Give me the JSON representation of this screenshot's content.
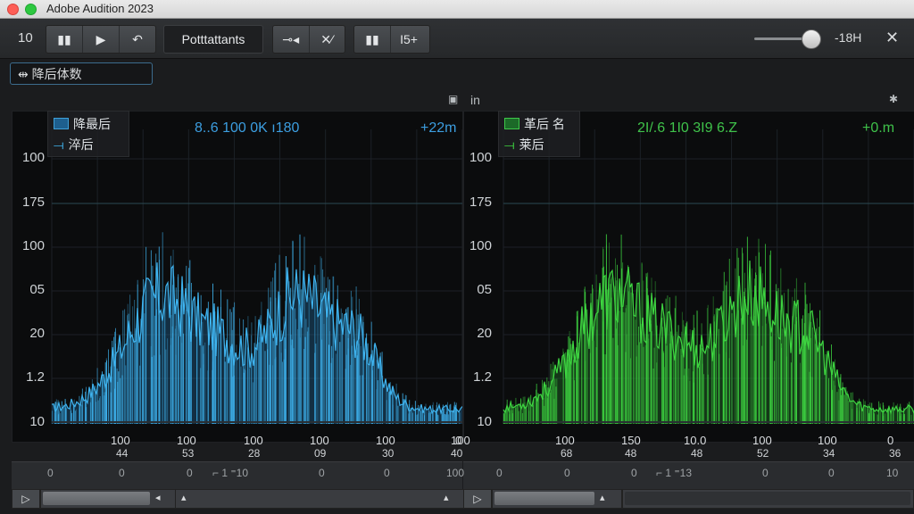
{
  "window": {
    "title": "Adobe Audition 2023"
  },
  "toolbar": {
    "left_value": "10",
    "transport": [
      "▮▮",
      "▶",
      "↶"
    ],
    "main_button": "Potttattants",
    "tools": [
      "⊸◂",
      "✕⁄"
    ],
    "right_group": [
      "▮▮",
      "I5+"
    ],
    "right_value": "-18H",
    "close_glyph": "✕"
  },
  "search": {
    "value": "⇹ 降后体数"
  },
  "panel_labels": {
    "mid": "in"
  },
  "left_panel": {
    "legend": [
      {
        "label": "降最后"
      },
      {
        "label": "淬后"
      }
    ],
    "readout": "8..6  100  0K  ı180",
    "readout_right": "+22m",
    "y_ticks": [
      "100",
      "175",
      "100",
      "05",
      "20",
      "1.2",
      "10"
    ],
    "x_ticks": [
      "100",
      "100",
      "100",
      "100",
      "100",
      "100",
      "0"
    ],
    "x_ticks2": [
      "44",
      "53",
      "28",
      "09",
      "30",
      "40"
    ],
    "sub_values": [
      "0",
      "0",
      "0",
      "⌐ 1 ⁼10",
      "0",
      "0",
      "100"
    ],
    "color": "#3fb4f0"
  },
  "right_panel": {
    "legend": [
      {
        "label": "革后 名"
      },
      {
        "label": "莱后"
      }
    ],
    "readout": "2I/.6  1I0  3I9  6.Z",
    "readout_right": "+0.m",
    "y_ticks": [
      "100",
      "175",
      "100",
      "05",
      "20",
      "1.2",
      "10"
    ],
    "x_ticks": [
      "100",
      "150",
      "10.0",
      "100",
      "100",
      "0"
    ],
    "x_ticks2": [
      "68",
      "48",
      "48",
      "52",
      "34",
      "36"
    ],
    "sub_values": [
      "0",
      "0",
      "0",
      "⌐ 1 ⁼13",
      "0",
      "0",
      "10"
    ],
    "color": "#3ed641"
  },
  "scrollbar": {
    "play_glyph": "▷",
    "left_arrow": "◂",
    "up_arrow": "▴"
  }
}
